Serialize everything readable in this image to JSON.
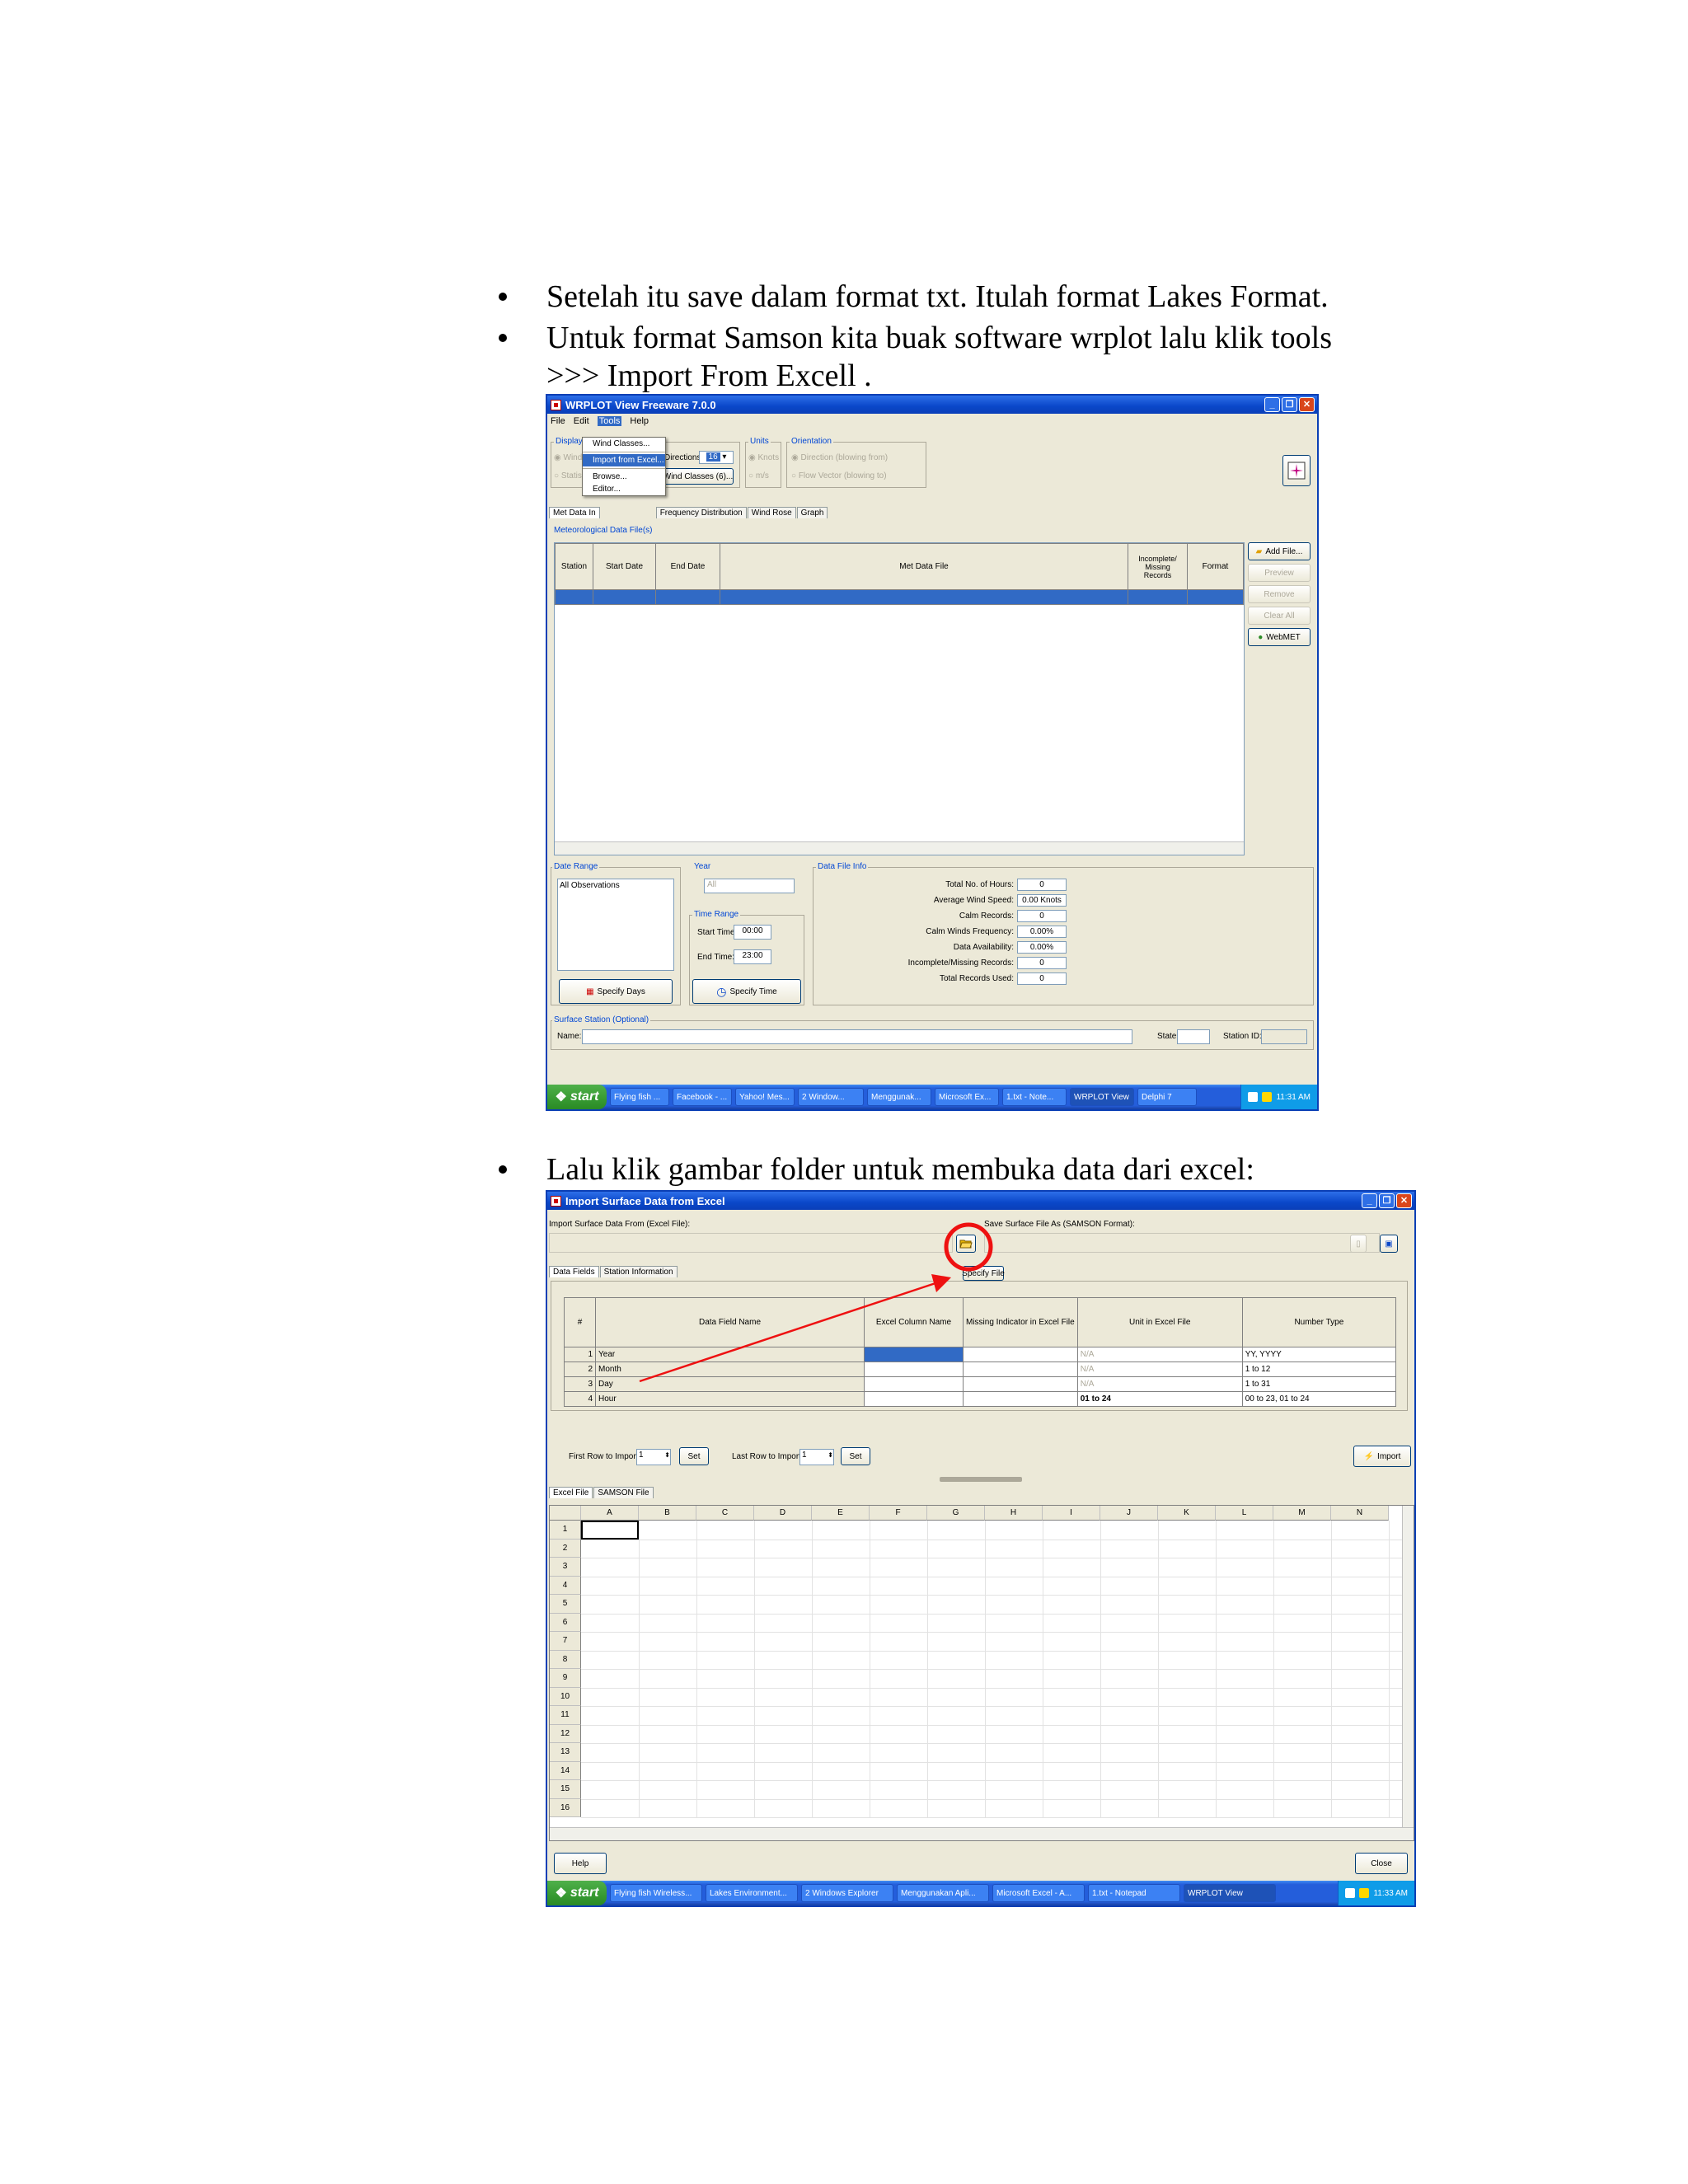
{
  "bullets": [
    "Setelah itu save dalam format txt. Itulah format Lakes Format.",
    "Untuk format Samson kita buak software wrplot  lalu klik tools",
    ">>> Import From Excell .",
    "Lalu klik gambar folder untuk membuka data dari excel:"
  ],
  "wrplot": {
    "title": "WRPLOT View Freeware 7.0.0",
    "menu": [
      "File",
      "Edit",
      "Tools",
      "Help"
    ],
    "tools_menu": [
      "Wind Classes...",
      "Import from Excel...",
      "Browse...",
      "Editor..."
    ],
    "display_label": "Display",
    "radio_1": "Wind",
    "radio_2": "Statis",
    "directions_label": "Directions:",
    "directions_value": "16",
    "wind_classes_btn": "Wind Classes (6)...",
    "units_label": "Units",
    "unit_knots": "Knots",
    "unit_ms": "m/s",
    "orientation_label": "Orientation",
    "orient_1": "Direction (blowing from)",
    "orient_2": "Flow Vector (blowing to)",
    "tabs": [
      "Met Data In",
      "Frequency Distribution",
      "Wind Rose",
      "Graph"
    ],
    "met_group": "Meteorological Data File(s)",
    "columns": [
      "Station",
      "Start Date",
      "End Date",
      "Met Data File",
      "Incomplete/ Missing Records",
      "Format"
    ],
    "side_buttons": [
      "Add File...",
      "Preview",
      "Remove",
      "Clear All",
      "WebMET"
    ],
    "date_range_label": "Date Range",
    "date_range_value": "All Observations",
    "year_label": "Year",
    "year_value": "All",
    "time_range_label": "Time Range",
    "start_time_label": "Start Time:",
    "start_time": "00:00",
    "end_time_label": "End Time:",
    "end_time": "23:00",
    "specify_days": "Specify Days",
    "specify_time": "Specify Time",
    "file_info_label": "Data File Info",
    "file_info": [
      {
        "label": "Total No. of Hours:",
        "value": "0"
      },
      {
        "label": "Average Wind Speed:",
        "value": "0.00 Knots"
      },
      {
        "label": "Calm Records:",
        "value": "0"
      },
      {
        "label": "Calm Winds Frequency:",
        "value": "0.00%"
      },
      {
        "label": "Data Availability:",
        "value": "0.00%"
      },
      {
        "label": "Incomplete/Missing Records:",
        "value": "0"
      },
      {
        "label": "Total Records Used:",
        "value": "0"
      }
    ],
    "surface_label": "Surface Station (Optional)",
    "name_label": "Name:",
    "state_label": "State:",
    "station_id_label": "Station ID:",
    "taskbar": {
      "start": "start",
      "items": [
        "Flying fish ...",
        "Facebook - ...",
        "Yahoo! Mes...",
        "2 Window...",
        "Menggunak...",
        "Microsoft Ex...",
        "1.txt - Note...",
        "WRPLOT View",
        "Delphi 7"
      ],
      "clock": "11:31 AM"
    }
  },
  "importer": {
    "title": "Import Surface Data from Excel",
    "from_label": "Import Surface Data From (Excel File):",
    "save_label": "Save Surface File As (SAMSON Format):",
    "tabs": [
      "Data Fields",
      "Station Information"
    ],
    "specify_file": "Specify File",
    "columns": [
      "#",
      "Data Field Name",
      "Excel Column Name",
      "Missing Indicator in Excel File",
      "Unit in Excel File",
      "Number Type"
    ],
    "rows": [
      {
        "n": "1",
        "name": "Year",
        "unit": "N/A",
        "type": "YY, YYYY"
      },
      {
        "n": "2",
        "name": "Month",
        "unit": "N/A",
        "type": "1 to 12"
      },
      {
        "n": "3",
        "name": "Day",
        "unit": "N/A",
        "type": "1 to 31"
      },
      {
        "n": "4",
        "name": "Hour",
        "unit": "01 to 24",
        "type": "00 to 23, 01 to 24"
      }
    ],
    "first_row_label": "First Row to Import:",
    "first_row_value": "1",
    "last_row_label": "Last Row to Import:",
    "last_row_value": "1",
    "set_btn": "Set",
    "import_btn": "Import",
    "sheet_tabs": [
      "Excel File",
      "SAMSON File"
    ],
    "sheet_cols": [
      "A",
      "B",
      "C",
      "D",
      "E",
      "F",
      "G",
      "H",
      "I",
      "J",
      "K",
      "L",
      "M",
      "N"
    ],
    "sheet_rows": [
      "1",
      "2",
      "3",
      "4",
      "5",
      "6",
      "7",
      "8",
      "9",
      "10",
      "11",
      "12",
      "13",
      "14",
      "15",
      "16"
    ],
    "help_btn": "Help",
    "close_btn": "Close",
    "taskbar": {
      "start": "start",
      "items": [
        "Flying fish Wireless...",
        "Lakes Environment...",
        "2 Windows Explorer",
        "Menggunakan Apli...",
        "Microsoft Excel - A...",
        "1.txt - Notepad",
        "WRPLOT View"
      ],
      "clock": "11:33 AM"
    }
  },
  "colors": {
    "xp_blue": "#0a47c9",
    "selection": "#316ac5",
    "annotation_red": "#ee1111"
  }
}
